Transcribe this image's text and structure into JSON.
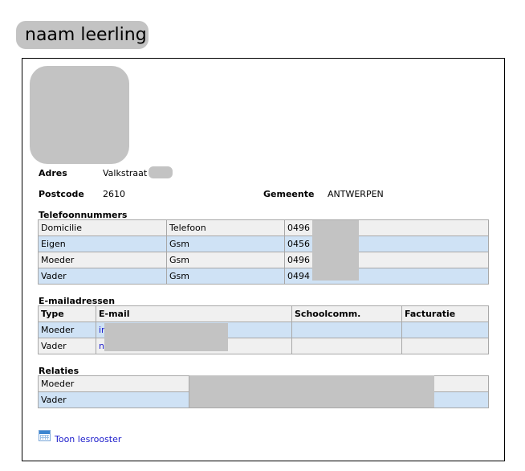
{
  "student": {
    "name": "naam leerling"
  },
  "address": {
    "street_label": "Adres",
    "street_value": "Valkstraat",
    "postcode_label": "Postcode",
    "postcode_value": "2610",
    "municipality_label": "Gemeente",
    "municipality_value": "ANTWERPEN"
  },
  "phones": {
    "title": "Telefoonnummers",
    "rows": [
      {
        "who": "Domicilie",
        "type": "Telefoon",
        "number": "0496"
      },
      {
        "who": "Eigen",
        "type": "Gsm",
        "number": "0456"
      },
      {
        "who": "Moeder",
        "type": "Gsm",
        "number": "0496"
      },
      {
        "who": "Vader",
        "type": "Gsm",
        "number": "0494"
      }
    ]
  },
  "emails": {
    "title": "E-mailadressen",
    "headers": {
      "type": "Type",
      "email": "E-mail",
      "school": "Schoolcomm.",
      "billing": "Facturatie"
    },
    "rows": [
      {
        "type": "Moeder",
        "email": "ir"
      },
      {
        "type": "Vader",
        "email": "n"
      }
    ]
  },
  "relations": {
    "title": "Relaties",
    "rows": [
      {
        "who": "Moeder"
      },
      {
        "who": "Vader"
      }
    ]
  },
  "actions": {
    "schedule_link": "Toon lesrooster",
    "schedule_icon": "calendar-icon"
  }
}
